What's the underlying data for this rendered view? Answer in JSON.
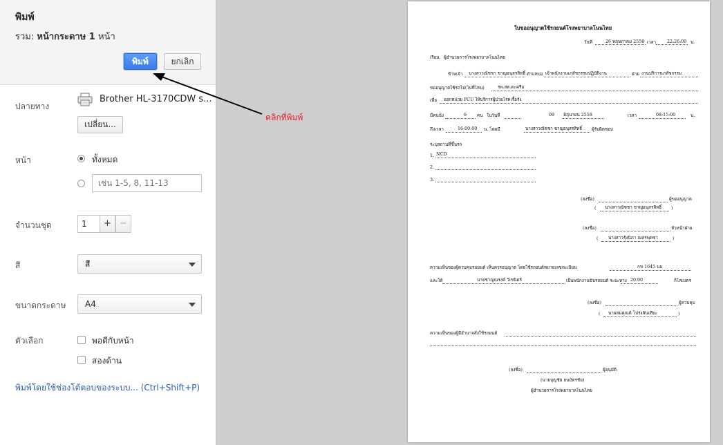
{
  "dialog": {
    "title": "พิมพ์",
    "summary_prefix": "รวม:",
    "summary_bold": "หน้ากระดาษ 1",
    "summary_suffix": "หน้า",
    "print_button": "พิมพ์",
    "cancel_button": "ยกเลิก"
  },
  "destination": {
    "label": "ปลายทาง",
    "printer_name": "Brother HL-3170CDW s...",
    "change_button": "เปลี่ยน..."
  },
  "pages": {
    "label": "หน้า",
    "all_option": "ทั้งหมด",
    "range_placeholder": "เช่น 1-5, 8, 11-13",
    "selected": "all"
  },
  "copies": {
    "label": "จำนวนชุด",
    "value": "1",
    "plus": "+",
    "minus": "−"
  },
  "color": {
    "label": "สี",
    "selected": "สี"
  },
  "paper_size": {
    "label": "ขนาดกระดาษ",
    "selected": "A4"
  },
  "options": {
    "label": "ตัวเลือก",
    "fit_to_page": "พอดีกับหน้า",
    "two_sided": "สองด้าน",
    "fit_to_page_checked": false,
    "two_sided_checked": false
  },
  "system_dialog_link": "พิมพ์โดยใช้ช่องโต้ตอบของระบบ... (Ctrl+Shift+P)",
  "annotation": {
    "text": "คลิกที่พิมพ์",
    "color": "#e32020"
  },
  "icons": {
    "printer": "printer-icon",
    "arrow": "arrow-pointer-icon"
  },
  "colors": {
    "print_button": "#3a7be6",
    "link": "#2a5fb0",
    "preview_background": "#cfcfcf"
  },
  "document": {
    "title": "ใบขออนุญาตใช้รถยนต์โรงพยาบาลโนนไทย",
    "date_prefix": "วันที่",
    "date": "26 พฤษภาคม 2558",
    "time_prefix": "เวลา",
    "time": "22:26:00",
    "time_suffix": "น.",
    "to_label": "เรียน",
    "to": "ผู้อำนวยการโรงพยาบาลโนนไทย",
    "name_prefix": "ข้าพเจ้า",
    "requester": "นางสาวณัชชา ชาญอนุสรสิทธิ์",
    "position_prefix": "ตำแหน่ง",
    "position": "เจ้าพนักงานเภสัชกรรมปฏิบัติงาน",
    "dept_prefix": "ฝ่าย",
    "department": "งานบริการเภสัชกรรม",
    "go_prefix": "ขออนุญาตใช้รถไป(ไปที่ไหน)",
    "destination": "รพ.สต.ดะครือ",
    "purpose_prefix": "เพื่อ",
    "purpose": "ออกหน่วย PCU ให้บริการผู้ป่วยโรคเรื้อรัง",
    "count_prefix": "มีคนนั่ง",
    "passengers": "6",
    "count_suffix": "คน",
    "on_date_prefix": "ในวันที่",
    "day": "09",
    "month_year": "มิถุนายน 2558",
    "start_prefix": "เวลา",
    "start_time": "08:15:00",
    "start_suffix": "น.",
    "end_prefix": "ถึงเวลา",
    "end_time": "16:00:00",
    "end_suffix": "น. โดยมี",
    "supervisor": "นางสาวณัชชา ชาญอนุสรสิทธิ์",
    "supervisor_role": "ผู้รับผิดชอบ",
    "places_heading": "ระบุสถานที่ขึ้นรถ",
    "places": [
      "1.",
      "2.",
      "3."
    ],
    "place_1": "NCD",
    "sign_prefix": "(ลงชื่อ)",
    "requester_role": "ผู้ขออนุญาต",
    "requester_sign": "นางสาวณัชชา ชาญอนุสรสิทธิ์",
    "head_role": "หัวหน้าฝ่าย",
    "head_sign": "นางสาวรุ้งนิภา ณครพุดซา",
    "opinion_1": "ความเห็นของผู้ควบคุมรถยนต์ เห็นควรอนุญาต โดยใช้รถยนต์หมายเลขทะเบียน",
    "plate": "กข 1645 นม",
    "driver_prefix": "และให้",
    "driver": "นายชาญณรงค์ วิเชนิตร์",
    "driver_mid": "เป็นพนักงานขับรถยนต์ ระยะทาง",
    "distance": "20.00",
    "distance_suffix": "กิโลเมตร",
    "controller_role": "ผู้ควบคุม",
    "controller_sign": "นายสมคุณต์ โปร่งสันเทียะ",
    "opinion_2": "ความเห็นของผู้มีอำนาจสั่งใช้รถยนต์",
    "approver_role": "ผู้อนุมัติ",
    "approver_name": "(นายบุญชัย ธนบัตรชัย)",
    "approver_title": "ผู้อำนวยการโรงพยาบาลโนนไทย"
  }
}
